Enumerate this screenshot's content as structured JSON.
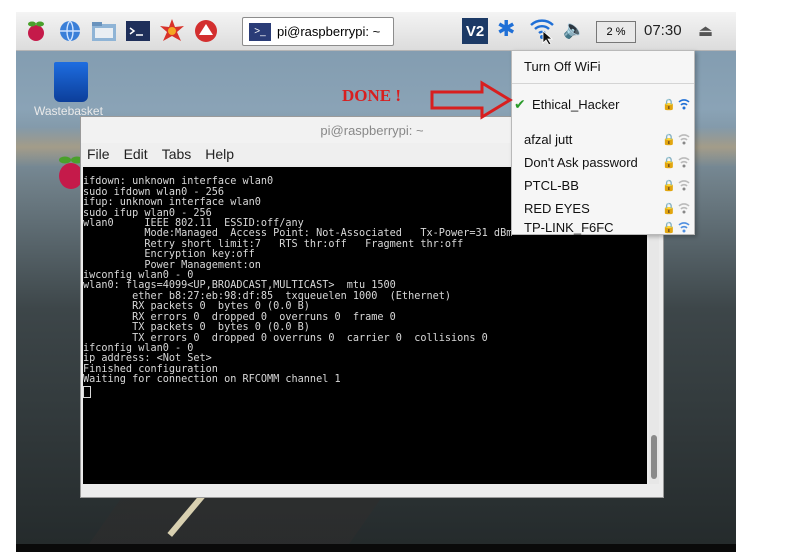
{
  "taskbar": {
    "task_title": "pi@raspberrypi: ~",
    "vnc_label": "V2",
    "cpu": "2 %",
    "clock": "07:30"
  },
  "desktop": {
    "wastebasket_label": "Wastebasket"
  },
  "terminal": {
    "title": "pi@raspberrypi: ~",
    "menu": [
      "File",
      "Edit",
      "Tabs",
      "Help"
    ],
    "lines": [
      "ifdown: unknown interface wlan0",
      "sudo ifdown wlan0 - 256",
      "ifup: unknown interface wlan0",
      "sudo ifup wlan0 - 256",
      "wlan0     IEEE 802.11  ESSID:off/any",
      "          Mode:Managed  Access Point: Not-Associated   Tx-Power=31 dBm",
      "          Retry short limit:7   RTS thr:off   Fragment thr:off",
      "          Encryption key:off",
      "          Power Management:on",
      "",
      "iwconfig wlan0 - 0",
      "wlan0: flags=4099<UP,BROADCAST,MULTICAST>  mtu 1500",
      "        ether b8:27:eb:98:df:85  txqueuelen 1000  (Ethernet)",
      "        RX packets 0  bytes 0 (0.0 B)",
      "        RX errors 0  dropped 0  overruns 0  frame 0",
      "        TX packets 0  bytes 0 (0.0 B)",
      "        TX errors 0  dropped 0 overruns 0  carrier 0  collisions 0",
      "",
      "ifconfig wlan0 - 0",
      "ip address: <Not Set>",
      "Finished configuration",
      "",
      "Waiting for connection on RFCOMM channel 1"
    ]
  },
  "wifi_menu": {
    "turn_off": "Turn Off WiFi",
    "connected": "Ethical_Hacker",
    "networks": [
      "afzal jutt",
      "Don't Ask password",
      "PTCL-BB",
      "RED EYES",
      "TP-LINK_F6FC"
    ]
  },
  "annotation": {
    "text": "DONE !",
    "color": "#d81f1f"
  }
}
